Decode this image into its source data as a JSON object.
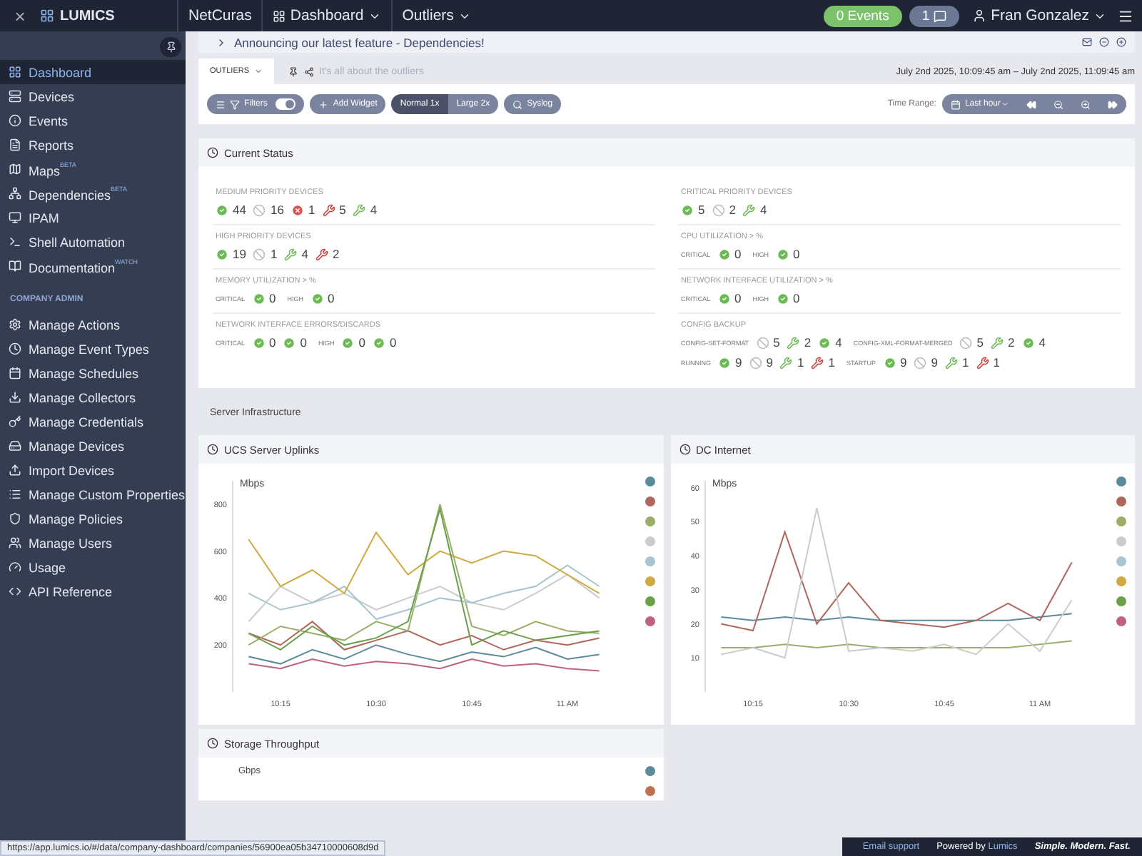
{
  "top_bar": {
    "close": "×",
    "logo": "LUMICS",
    "breadcrumbs": [
      {
        "label": "NetCuras",
        "has_caret": false,
        "has_icon": false
      },
      {
        "label": "Dashboard",
        "has_caret": true,
        "has_icon": true
      },
      {
        "label": "Outliers",
        "has_caret": true,
        "has_icon": false
      }
    ],
    "events_badge": "0 Events",
    "messages_badge": "1",
    "user": "Fran Gonzalez"
  },
  "sidebar": {
    "items": [
      {
        "label": "Dashboard",
        "selected": true
      },
      {
        "label": "Devices",
        "selected": false
      },
      {
        "label": "Events",
        "selected": false
      },
      {
        "label": "Reports",
        "selected": false
      },
      {
        "label": "Maps$^{BETA}$",
        "selected": false
      },
      {
        "label": "Dependencies$^{BETA}$",
        "selected": false
      },
      {
        "label": "IPAM",
        "selected": false
      },
      {
        "label": "Shell Automation",
        "selected": false
      },
      {
        "label": "Documentation$^{WATCH}$",
        "selected": false
      }
    ],
    "section_title": "COMPANY ADMIN",
    "admin_items": [
      {
        "label": "Manage Actions",
        "selected": false
      },
      {
        "label": "Manage Event Types",
        "selected": false
      },
      {
        "label": "Manage Schedules",
        "selected": false
      },
      {
        "label": "Manage Collectors",
        "selected": false
      },
      {
        "label": "Manage Credentials",
        "selected": false
      },
      {
        "label": "Manage Devices",
        "selected": false
      },
      {
        "label": "Import Devices",
        "selected": false
      },
      {
        "label": "Manage Custom Properties",
        "selected": false
      },
      {
        "label": "Manage Policies",
        "selected": false
      },
      {
        "label": "Manage Users",
        "selected": false
      },
      {
        "label": "Usage",
        "selected": false
      },
      {
        "label": "API Reference",
        "selected": false
      }
    ]
  },
  "announcement": "Announcing our latest feature - Dependencies!",
  "dashboard_tab": {
    "label": "OUTLIERS",
    "description": "It's all about the outliers"
  },
  "date_range": "July 2nd 2025, 10:09:45 am – July 2nd 2025, 11:09:45 am",
  "toolbar": {
    "filters": "Filters",
    "filters_on": true,
    "add_widget": "Add Widget",
    "sizes": [
      {
        "label": "Normal 1x",
        "selected": true
      },
      {
        "label": "Large 2x",
        "selected": false
      }
    ],
    "syslog": "Syslog",
    "time_range_label": "Time Range:",
    "time_range": "Last hour"
  },
  "current_status": {
    "title": "Current Status",
    "columns": [
      [
        {
          "label": "MEDIUM PRIORITY DEVICES",
          "groups": [
            {
              "counts": [
                {
                  "kind": "ok",
                  "text": "44"
                },
                {
                  "kind": "disabled",
                  "text": "16"
                },
                {
                  "kind": "error",
                  "text": "1"
                },
                {
                  "kind": "wrench_red",
                  "text": "5"
                },
                {
                  "kind": "wrench_green",
                  "text": "4"
                }
              ]
            }
          ]
        },
        {
          "label": "HIGH PRIORITY DEVICES",
          "groups": [
            {
              "counts": [
                {
                  "kind": "ok",
                  "text": "19"
                },
                {
                  "kind": "disabled",
                  "text": "1"
                },
                {
                  "kind": "wrench_green",
                  "text": "4"
                },
                {
                  "kind": "wrench_red",
                  "text": "2"
                }
              ]
            }
          ]
        },
        {
          "label": "MEMORY UTILIZATION > %",
          "groups": [
            {
              "tag": "CRITICAL",
              "counts": [
                {
                  "kind": "ok",
                  "text": "0"
                }
              ]
            },
            {
              "tag": "HIGH",
              "counts": [
                {
                  "kind": "ok",
                  "text": "0"
                }
              ]
            }
          ]
        },
        {
          "label": "NETWORK INTERFACE ERRORS/DISCARDS",
          "groups": [
            {
              "tag": "CRITICAL",
              "counts": [
                {
                  "kind": "ok",
                  "text": "0"
                },
                {
                  "kind": "ok",
                  "text": "0"
                }
              ]
            },
            {
              "tag": "HIGH",
              "counts": [
                {
                  "kind": "ok",
                  "text": "0"
                },
                {
                  "kind": "ok",
                  "text": "0"
                }
              ]
            }
          ]
        }
      ],
      [
        {
          "label": "CRITICAL PRIORITY DEVICES",
          "groups": [
            {
              "counts": [
                {
                  "kind": "ok",
                  "text": "5"
                },
                {
                  "kind": "disabled",
                  "text": "2"
                },
                {
                  "kind": "wrench_green",
                  "text": "4"
                }
              ]
            }
          ]
        },
        {
          "label": "CPU UTILIZATION > %",
          "groups": [
            {
              "tag": "CRITICAL",
              "counts": [
                {
                  "kind": "ok",
                  "text": "0"
                }
              ]
            },
            {
              "tag": "HIGH",
              "counts": [
                {
                  "kind": "ok",
                  "text": "0"
                }
              ]
            }
          ]
        },
        {
          "label": "NETWORK INTERFACE UTILIZATION > %",
          "groups": [
            {
              "tag": "CRITICAL",
              "counts": [
                {
                  "kind": "ok",
                  "text": "0"
                }
              ]
            },
            {
              "tag": "HIGH",
              "counts": [
                {
                  "kind": "ok",
                  "text": "0"
                }
              ]
            }
          ]
        },
        {
          "label": "CONFIG BACKUP",
          "groups": [
            {
              "tag": "CONFIG-SET-FORMAT",
              "counts": [
                {
                  "kind": "disabled",
                  "text": "5"
                },
                {
                  "kind": "wrench_green",
                  "text": "2"
                },
                {
                  "kind": "ok",
                  "text": "4"
                }
              ]
            },
            {
              "tag": "CONFIG-XML-FORMAT-MERGED",
              "counts": [
                {
                  "kind": "disabled",
                  "text": "5"
                },
                {
                  "kind": "wrench_green",
                  "text": "2"
                },
                {
                  "kind": "ok",
                  "text": "4"
                }
              ]
            },
            {
              "tag": "RUNNING",
              "counts": [
                {
                  "kind": "ok",
                  "text": "9"
                },
                {
                  "kind": "disabled",
                  "text": "9"
                },
                {
                  "kind": "wrench_green",
                  "text": "1"
                },
                {
                  "kind": "wrench_red",
                  "text": "1"
                }
              ]
            },
            {
              "tag": "STARTUP",
              "counts": [
                {
                  "kind": "ok",
                  "text": "9"
                },
                {
                  "kind": "disabled",
                  "text": "9"
                },
                {
                  "kind": "wrench_green",
                  "text": "1"
                },
                {
                  "kind": "wrench_red",
                  "text": "1"
                }
              ]
            }
          ]
        }
      ]
    ]
  },
  "section_heading": "Server Infrastructure",
  "charts": [
    {
      "title": "UCS Server Uplinks",
      "chart_data": {
        "type": "line",
        "ylabel": "Mbps",
        "categories": [
          null,
          "10:15",
          null,
          null,
          "10:30",
          null,
          null,
          "10:45",
          null,
          null,
          "11 AM",
          null
        ],
        "ylim": [
          0,
          900
        ],
        "yticks": [
          200,
          400,
          600,
          800
        ],
        "series": [
          {
            "color": "#5b8a9a",
            "values": [
              150,
              120,
              180,
              140,
              200,
              160,
              130,
              170,
              150,
              190,
              140,
              160
            ]
          },
          {
            "color": "#b0665a",
            "values": [
              250,
              200,
              300,
              180,
              220,
              260,
              200,
              240,
              180,
              220,
              200,
              230
            ]
          },
          {
            "color": "#9aae6a",
            "values": [
              200,
              280,
              250,
              220,
              300,
              260,
              800,
              280,
              240,
              300,
              260,
              250
            ]
          },
          {
            "color": "#c8cccc",
            "values": [
              300,
              450,
              380,
              420,
              350,
              400,
              450,
              380,
              350,
              420,
              500,
              400
            ]
          },
          {
            "color": "#a8c4cc",
            "values": [
              420,
              350,
              380,
              450,
              310,
              350,
              400,
              380,
              420,
              450,
              540,
              450
            ]
          },
          {
            "color": "#d0aa40",
            "values": [
              650,
              450,
              520,
              420,
              680,
              500,
              600,
              550,
              600,
              580,
              500,
              420
            ]
          },
          {
            "color": "#6aa04a",
            "values": [
              250,
              180,
              280,
              200,
              230,
              300,
              780,
              200,
              260,
              220,
              240,
              260
            ]
          },
          {
            "color": "#c06080",
            "values": [
              120,
              100,
              140,
              110,
              130,
              120,
              100,
              140,
              110,
              120,
              100,
              90
            ]
          }
        ]
      }
    },
    {
      "title": "DC Internet",
      "chart_data": {
        "type": "line",
        "ylabel": "Mbps",
        "categories": [
          null,
          "10:15",
          null,
          null,
          "10:30",
          null,
          null,
          "10:45",
          null,
          null,
          "11 AM",
          null
        ],
        "ylim": [
          0,
          62
        ],
        "yticks": [
          10,
          20,
          30,
          40,
          50,
          60
        ],
        "series": [
          {
            "color": "#5b8a9a",
            "values": [
              22,
              21,
              22,
              21,
              22,
              21,
              21,
              21,
              21,
              21,
              22,
              23
            ]
          },
          {
            "color": "#b0665a",
            "values": [
              20,
              18,
              47,
              20,
              32,
              21,
              20,
              19,
              21,
              26,
              21,
              38
            ]
          },
          {
            "color": "#9aae6a",
            "values": [
              13,
              13,
              14,
              13,
              14,
              13,
              13,
              13,
              13,
              13,
              14,
              15
            ]
          },
          {
            "color": "#c8cccc",
            "values": [
              11,
              13,
              10,
              54,
              12,
              13,
              12,
              14,
              11,
              20,
              12,
              27
            ]
          },
          {
            "color": "#a8c4cc",
            "values": [
              null,
              null,
              null,
              null,
              null,
              null,
              null,
              null,
              null,
              null,
              null,
              null
            ]
          },
          {
            "color": "#d0aa40",
            "values": [
              null,
              null,
              null,
              null,
              null,
              null,
              null,
              null,
              null,
              null,
              null,
              null
            ]
          },
          {
            "color": "#6aa04a",
            "values": [
              null,
              null,
              null,
              null,
              null,
              null,
              null,
              null,
              null,
              null,
              null,
              null
            ]
          },
          {
            "color": "#c06080",
            "values": [
              null,
              null,
              null,
              null,
              null,
              null,
              null,
              null,
              null,
              null,
              null,
              null
            ]
          }
        ]
      }
    }
  ],
  "storage": {
    "title": "Storage Throughput",
    "unit": "Gbps",
    "legend": [
      {
        "color": "#5b8a9a"
      },
      {
        "color": "#c07050"
      }
    ]
  },
  "status_url": "https://app.lumics.io/#/data/company-dashboard/companies/56900ea05b34710000608d9d",
  "footer": {
    "email": "Email support",
    "powered": "Powered by **Lumics**",
    "slogan": "Simple. Modern. Fast."
  }
}
